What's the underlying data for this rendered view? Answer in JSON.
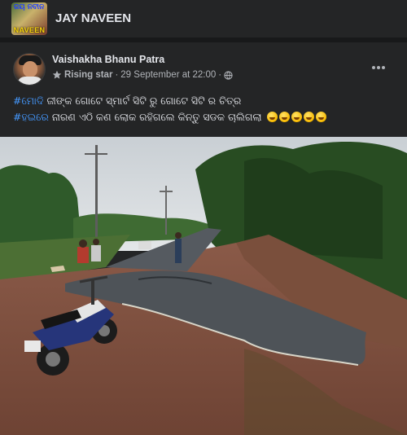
{
  "group": {
    "title": "JAY NAVEEN",
    "avatar_caption": "NAVEEN",
    "avatar_top_text": "ଜୟ ନବୀନ"
  },
  "post": {
    "author": "Vaishakha Bhanu Patra",
    "badge": "Rising star",
    "timestamp": "29 September at 22:00",
    "separator": "·",
    "audience_icon": "globe-icon",
    "more_icon": "more-dots-icon",
    "line1": {
      "hashtag": "#ମୋଦି",
      "text": " ଜୀଙ୍କ ଗୋଟେ ସ୍ମାର୍ଟ ସିଟି ରୁ ଗୋଟେ ସିଟି ର ଚିତ୍ର"
    },
    "line2": {
      "hashtag": "#ହଇରେ",
      "text": " ନାରଣ ଏଠି କଣ ଲୋକ ରହିଗଲେ କିନ୍ତୁ ସଡକ ଚାଲିଗଲା ",
      "emoji_count": 5
    },
    "photo_icon": "road-photo"
  },
  "colors": {
    "background": "#18191a",
    "card": "#242526",
    "hashtag": "#4599ff",
    "text_primary": "#e4e6eb",
    "text_secondary": "#b0b3b8"
  }
}
